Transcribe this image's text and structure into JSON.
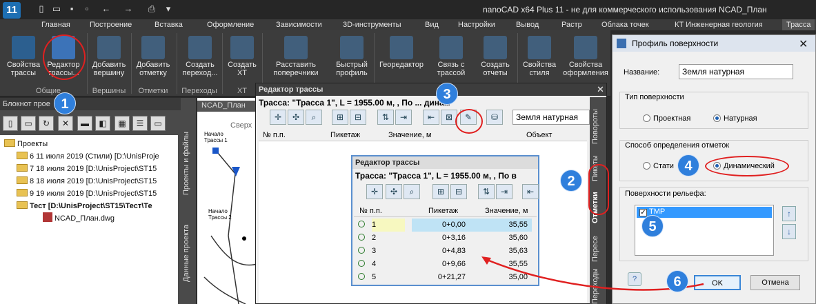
{
  "app": {
    "logo": "11",
    "title": "nanoCAD x64 Plus 11 - не для коммерческого использования NCAD_План"
  },
  "quick_access": [
    "new-icon",
    "open-icon",
    "save-icon",
    "saveas-icon",
    "undo-icon",
    "redo-icon",
    "print-icon",
    "dropdown-icon"
  ],
  "menu_tabs": [
    "Главная",
    "Построение",
    "Вставка",
    "Оформление",
    "Зависимости",
    "3D-инструменты",
    "Вид",
    "Настройки",
    "Вывод",
    "Растр",
    "Облака точек",
    "КТ Инженерная геология",
    "Трасса"
  ],
  "ribbon": {
    "buttons": [
      {
        "label": "Свойства трассы"
      },
      {
        "label": "Редактор трассы..."
      },
      {
        "label": "Добавить вершину"
      },
      {
        "label": "Добавить отметку"
      },
      {
        "label": "Создать переход..."
      },
      {
        "label": "Создать ХТ"
      },
      {
        "label": "Расставить поперечники"
      },
      {
        "label": "Быстрый профиль"
      },
      {
        "label": "Георедактор"
      },
      {
        "label": "Связь с трассой"
      },
      {
        "label": "Создать отчеты"
      },
      {
        "label": "Свойства стиля"
      },
      {
        "label": "Свойства оформления"
      }
    ],
    "groups": [
      "Общие",
      "Вершины",
      "Отметки",
      "Переходы",
      "ХТ"
    ]
  },
  "notebook": {
    "title": "Блокнот прое",
    "tree": [
      {
        "label": "Проекты",
        "level": 0
      },
      {
        "label": "6 11 июля 2019 (Стили) [D:\\UnisProje",
        "level": 1
      },
      {
        "label": "7 18 июля 2019 [D:\\UnisProject\\ST15",
        "level": 1
      },
      {
        "label": "8 18 июля 2019 [D:\\UnisProject\\ST15",
        "level": 1
      },
      {
        "label": "9 19 июля 2019 [D:\\UnisProject\\ST15",
        "level": 1
      },
      {
        "label": "Тест [D:\\UnisProject\\ST15\\Тест\\Те",
        "level": 1,
        "bold": true
      },
      {
        "label": "NCAD_План.dwg",
        "level": 2
      }
    ],
    "side_tabs": [
      "Проекты и файлы",
      "Данные проекта"
    ]
  },
  "drawing": {
    "tab": "NCAD_План",
    "view_label": "Сверх",
    "labels": [
      "Начало Трассы 1",
      "Начало Трассы 2"
    ]
  },
  "route_editor": {
    "title": "Редактор трассы",
    "route": "Трасса: \"Трасса 1\", L = 1955.00 м, , По ... динам",
    "surface": "Земля натурная",
    "columns": [
      "№ п.п.",
      "Пикетаж",
      "Значение, м",
      "Объект"
    ],
    "side_tabs": [
      "Повороты",
      "Пикеты",
      "Отметки",
      "Переходы",
      "Пересе"
    ]
  },
  "zoom_editor": {
    "title": "Редактор трассы",
    "route": "Трасса: \"Трасса 1\", L = 1955.00 м, , По в",
    "columns": [
      "№ п.п.",
      "Пикетаж",
      "Значение, м"
    ],
    "rows": [
      {
        "n": "1",
        "pk": "0+0,00",
        "v": "35,55"
      },
      {
        "n": "2",
        "pk": "0+3,16",
        "v": "35,60"
      },
      {
        "n": "3",
        "pk": "0+4,83",
        "v": "35,63"
      },
      {
        "n": "4",
        "pk": "0+9,66",
        "v": "35,55"
      },
      {
        "n": "5",
        "pk": "0+21,27",
        "v": "35,00"
      }
    ]
  },
  "dialog": {
    "title": "Профиль поверхности",
    "name_label": "Название:",
    "name_value": "Земля натурная",
    "surface_type_label": "Тип поверхности",
    "opt_design": "Проектная",
    "opt_natural": "Натурная",
    "method_label": "Способ определения отметок",
    "opt_static": "Стати",
    "opt_dynamic": "Динамический",
    "relief_label": "Поверхности рельефа:",
    "relief_item": "TMP",
    "ok": "OK",
    "cancel": "Отмена"
  },
  "callouts": [
    "1",
    "2",
    "3",
    "4",
    "5",
    "6"
  ],
  "colors": {
    "accent": "#2f7fdc",
    "highlight": "#e02020",
    "selection": "#3399ff"
  }
}
